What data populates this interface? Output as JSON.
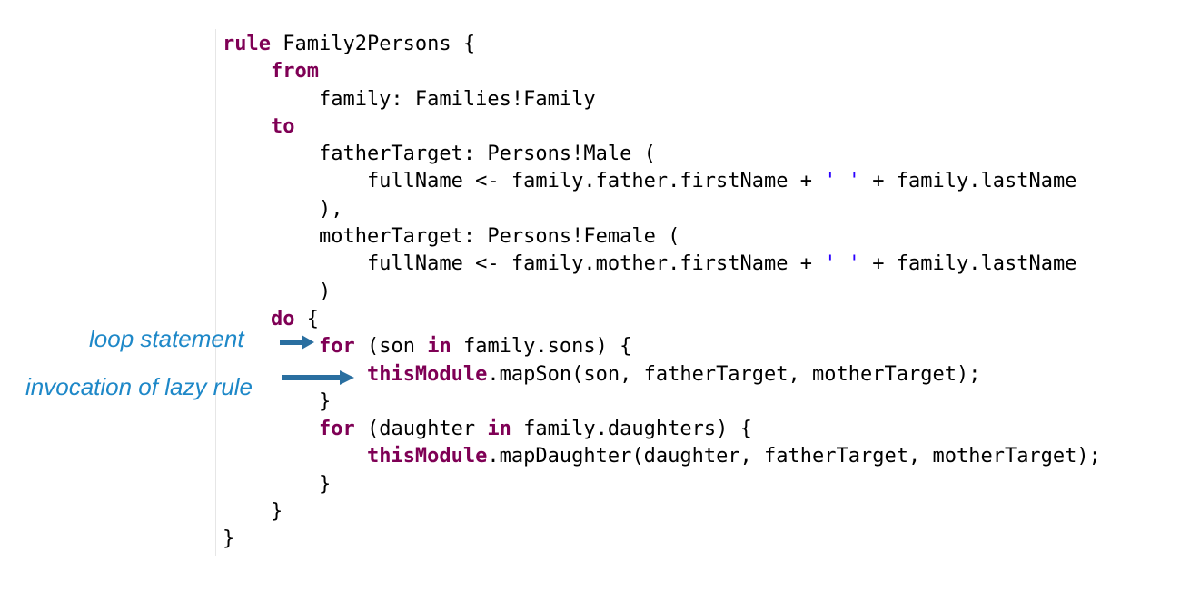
{
  "code": {
    "lines": [
      [
        {
          "t": "rule",
          "k": "kw"
        },
        {
          "t": " Family2Persons {",
          "k": ""
        }
      ],
      [
        {
          "t": "    ",
          "k": ""
        },
        {
          "t": "from",
          "k": "kw"
        }
      ],
      [
        {
          "t": "        family: Families!Family",
          "k": ""
        }
      ],
      [
        {
          "t": "    ",
          "k": ""
        },
        {
          "t": "to",
          "k": "kw"
        }
      ],
      [
        {
          "t": "        fatherTarget: Persons!Male (",
          "k": ""
        }
      ],
      [
        {
          "t": "            fullName <- family.father.firstName + ",
          "k": ""
        },
        {
          "t": "' '",
          "k": "str"
        },
        {
          "t": " + family.lastName",
          "k": ""
        }
      ],
      [
        {
          "t": "        ),",
          "k": ""
        }
      ],
      [
        {
          "t": "        motherTarget: Persons!Female (",
          "k": ""
        }
      ],
      [
        {
          "t": "            fullName <- family.mother.firstName + ",
          "k": ""
        },
        {
          "t": "' '",
          "k": "str"
        },
        {
          "t": " + family.lastName",
          "k": ""
        }
      ],
      [
        {
          "t": "        )",
          "k": ""
        }
      ],
      [
        {
          "t": "    ",
          "k": ""
        },
        {
          "t": "do",
          "k": "kw"
        },
        {
          "t": " {",
          "k": ""
        }
      ],
      [
        {
          "t": "        ",
          "k": ""
        },
        {
          "t": "for",
          "k": "kw"
        },
        {
          "t": " (son ",
          "k": ""
        },
        {
          "t": "in",
          "k": "kw"
        },
        {
          "t": " family.sons) {",
          "k": ""
        }
      ],
      [
        {
          "t": "            ",
          "k": ""
        },
        {
          "t": "thisModule",
          "k": "kw"
        },
        {
          "t": ".mapSon(son, fatherTarget, motherTarget);",
          "k": ""
        }
      ],
      [
        {
          "t": "        }",
          "k": ""
        }
      ],
      [
        {
          "t": "        ",
          "k": ""
        },
        {
          "t": "for",
          "k": "kw"
        },
        {
          "t": " (daughter ",
          "k": ""
        },
        {
          "t": "in",
          "k": "kw"
        },
        {
          "t": " family.daughters) {",
          "k": ""
        }
      ],
      [
        {
          "t": "            ",
          "k": ""
        },
        {
          "t": "thisModule",
          "k": "kw"
        },
        {
          "t": ".mapDaughter(daughter, fatherTarget, motherTarget);",
          "k": ""
        }
      ],
      [
        {
          "t": "        }",
          "k": ""
        }
      ],
      [
        {
          "t": "    }",
          "k": ""
        }
      ],
      [
        {
          "t": "}",
          "k": ""
        }
      ]
    ]
  },
  "annotations": {
    "loop": "loop statement",
    "lazy": "invocation of lazy rule"
  },
  "colors": {
    "keyword": "#7f0055",
    "string": "#2a00ff",
    "annotation": "#1e88c8",
    "arrow": "#2a6fa0"
  }
}
